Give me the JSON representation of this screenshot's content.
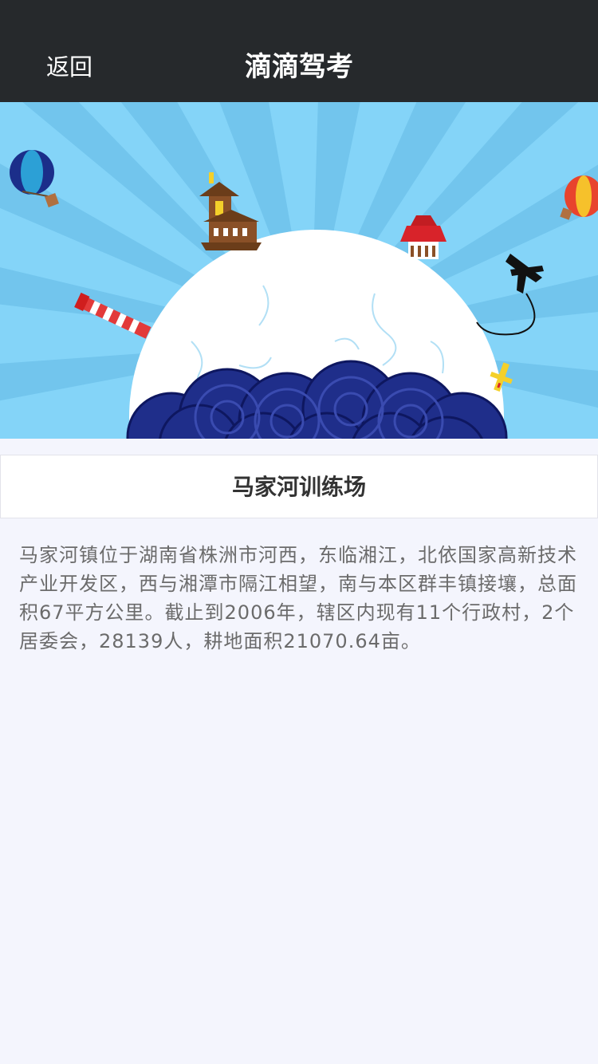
{
  "navbar": {
    "back_label": "返回",
    "title": "滴滴驾考"
  },
  "banner": {
    "description": "illustrated globe with landmarks, hot-air balloons and airplane on light blue sunburst"
  },
  "place": {
    "name": "马家河训练场",
    "description": "马家河镇位于湖南省株洲市河西，东临湘江，北依国家高新技术产业开发区，西与湘潭市隔江相望，南与本区群丰镇接壤，总面积67平方公里。截止到2006年，辖区内现有11个行政村，2个居委会，28139人，耕地面积21070.64亩。"
  },
  "colors": {
    "navbar_bg": "#26292c",
    "page_bg": "#f4f5fd",
    "sky": "#84d4f8",
    "globe": "#ffffff",
    "waves": "#1f2e8a"
  }
}
